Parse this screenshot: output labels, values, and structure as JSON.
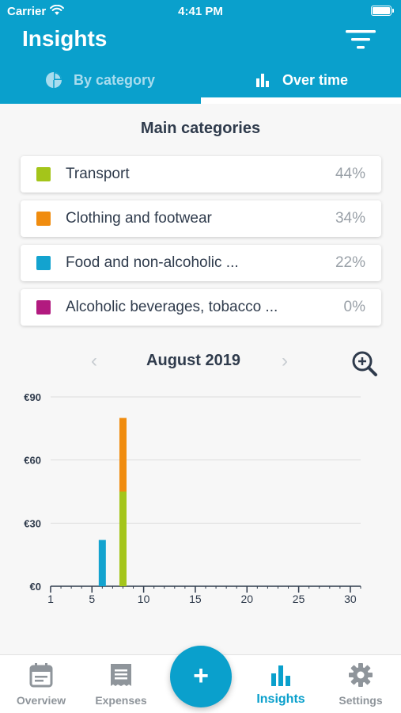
{
  "status_bar": {
    "carrier": "Carrier",
    "time": "4:41 PM"
  },
  "header": {
    "title": "Insights"
  },
  "tabs": [
    {
      "label": "By category",
      "icon": "pie-chart-icon",
      "active": false
    },
    {
      "label": "Over time",
      "icon": "bar-chart-icon",
      "active": true
    }
  ],
  "section": {
    "title": "Main categories"
  },
  "categories": [
    {
      "label": "Transport",
      "percent": "44%",
      "color": "#a4c51a"
    },
    {
      "label": "Clothing and footwear",
      "percent": "34%",
      "color": "#f08c0f"
    },
    {
      "label": "Food and non-alcoholic ...",
      "percent": "22%",
      "color": "#13a3cf"
    },
    {
      "label": "Alcoholic beverages, tobacco ...",
      "percent": "0%",
      "color": "#b21a7f"
    }
  ],
  "period": {
    "label": "August 2019",
    "prev_symbol": "‹",
    "next_symbol": "›"
  },
  "chart_data": {
    "type": "bar",
    "stacked": true,
    "xlim": [
      1,
      31
    ],
    "ylim": [
      0,
      90
    ],
    "x_ticks": [
      1,
      5,
      10,
      15,
      20,
      25,
      30
    ],
    "y_ticks": [
      0,
      30,
      60,
      90
    ],
    "y_tick_labels": [
      "€0",
      "€30",
      "€60",
      "€90"
    ],
    "grid": true,
    "series": [
      {
        "name": "Transport",
        "color": "#a4c51a",
        "points": [
          {
            "x": 8,
            "y": 45
          }
        ]
      },
      {
        "name": "Clothing and footwear",
        "color": "#f08c0f",
        "points": [
          {
            "x": 8,
            "y": 35
          }
        ]
      },
      {
        "name": "Food and non-alcoholic ...",
        "color": "#13a3cf",
        "points": [
          {
            "x": 6,
            "y": 22
          }
        ]
      }
    ]
  },
  "tabbar": {
    "items": [
      {
        "label": "Overview",
        "icon": "calendar-icon",
        "active": false
      },
      {
        "label": "Expenses",
        "icon": "receipt-icon",
        "active": false
      },
      {
        "label": "Insights",
        "icon": "bar-chart-icon",
        "active": true
      },
      {
        "label": "Settings",
        "icon": "gear-icon",
        "active": false
      }
    ],
    "add_symbol": "+"
  },
  "colors": {
    "accent": "#0aa0cc",
    "text": "#2f3b4c",
    "muted": "#9aa1a8"
  }
}
